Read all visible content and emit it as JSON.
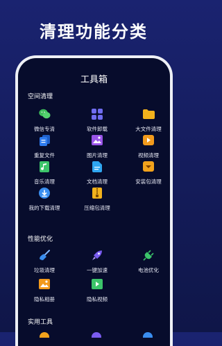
{
  "banner": {
    "title": "清理功能分类"
  },
  "screen": {
    "title": "工具箱"
  },
  "sections": [
    {
      "title": "空间清理"
    },
    {
      "title": "性能优化"
    },
    {
      "title": "实用工具"
    }
  ],
  "space": {
    "items": [
      {
        "label": "微信专清",
        "icon": "wechat-icon",
        "color": "#3dbd5a"
      },
      {
        "label": "软件卸载",
        "icon": "apps-grid-icon",
        "color": "#6f6cf0"
      },
      {
        "label": "大文件清理",
        "icon": "folder-icon",
        "color": "#f2b21c"
      },
      {
        "label": "重复文件",
        "icon": "duplicate-file-icon",
        "color": "#2f7cf0"
      },
      {
        "label": "图片清理",
        "icon": "image-icon",
        "color": "#9a55e8"
      },
      {
        "label": "视频清理",
        "icon": "video-play-icon",
        "color": "#f29a1c"
      },
      {
        "label": "音乐清理",
        "icon": "music-note-icon",
        "color": "#3cc46a"
      },
      {
        "label": "文档清理",
        "icon": "document-icon",
        "color": "#2fa6f0"
      },
      {
        "label": "安装包清理",
        "icon": "package-icon",
        "color": "#f2a21c"
      },
      {
        "label": "我的下载清理",
        "icon": "download-icon",
        "color": "#3a8ef0"
      },
      {
        "label": "压缩包清理",
        "icon": "zip-file-icon",
        "color": "#f2b21c"
      }
    ]
  },
  "performance": {
    "items": [
      {
        "label": "垃圾清理",
        "icon": "broom-icon",
        "color": "#3a8ef0"
      },
      {
        "label": "一键加速",
        "icon": "rocket-icon",
        "color": "#7a5cf0"
      },
      {
        "label": "电池优化",
        "icon": "plug-icon",
        "color": "#3cc46a"
      },
      {
        "label": "隐私相册",
        "icon": "private-album-icon",
        "color": "#f29a1c"
      },
      {
        "label": "隐私视频",
        "icon": "private-video-icon",
        "color": "#3cc46a"
      }
    ]
  }
}
